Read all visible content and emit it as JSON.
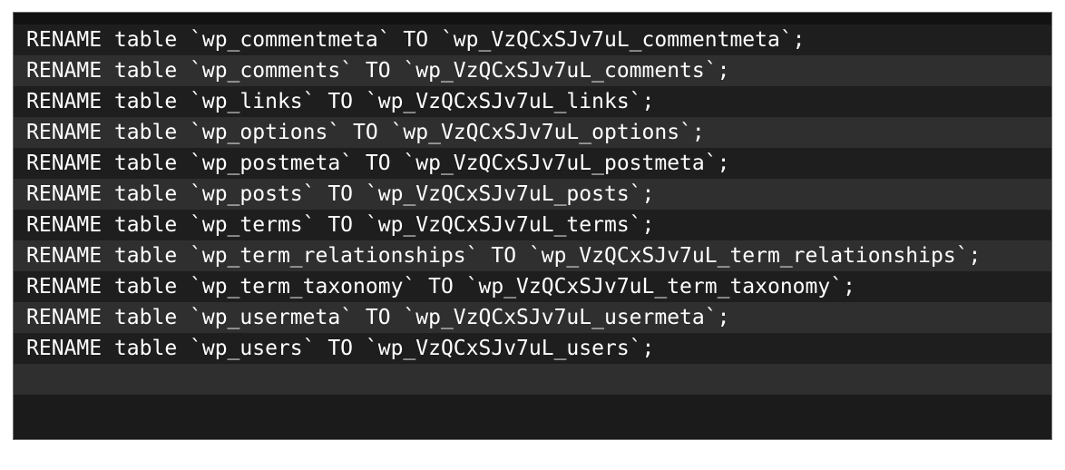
{
  "code_block": {
    "language": "sql",
    "table_prefix_old": "wp_",
    "table_prefix_new": "wp_VzQCxSJv7uL_",
    "colors": {
      "page_background": "#ffffff",
      "block_background": "#1b1b1b",
      "block_border": "#6f6f6f",
      "row_odd": "#1e1e1e",
      "row_even": "#2f2f2f",
      "text": "#ffffff"
    },
    "lines": [
      "RENAME table `wp_commentmeta` TO `wp_VzQCxSJv7uL_commentmeta`;",
      "RENAME table `wp_comments` TO `wp_VzQCxSJv7uL_comments`;",
      "RENAME table `wp_links` TO `wp_VzQCxSJv7uL_links`;",
      "RENAME table `wp_options` TO `wp_VzQCxSJv7uL_options`;",
      "RENAME table `wp_postmeta` TO `wp_VzQCxSJv7uL_postmeta`;",
      "RENAME table `wp_posts` TO `wp_VzQCxSJv7uL_posts`;",
      "RENAME table `wp_terms` TO `wp_VzQCxSJv7uL_terms`;",
      "RENAME table `wp_term_relationships` TO `wp_VzQCxSJv7uL_term_relationships`;",
      "RENAME table `wp_term_taxonomy` TO `wp_VzQCxSJv7uL_term_taxonomy`;",
      "RENAME table `wp_usermeta` TO `wp_VzQCxSJv7uL_usermeta`;",
      "RENAME table `wp_users` TO `wp_VzQCxSJv7uL_users`;",
      ""
    ]
  }
}
